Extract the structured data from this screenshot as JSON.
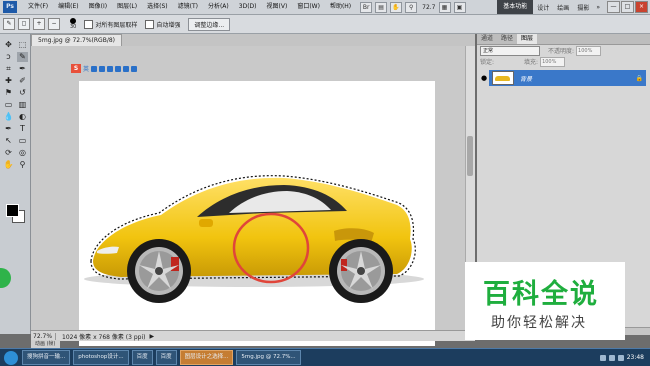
{
  "app": {
    "logo": "Ps"
  },
  "menu": [
    "文件(F)",
    "编辑(E)",
    "图像(I)",
    "图层(L)",
    "选择(S)",
    "滤镜(T)",
    "分析(A)",
    "3D(D)",
    "视图(V)",
    "窗口(W)",
    "帮助(H)"
  ],
  "menu_zoom": "72.7",
  "workspace": {
    "active": "基本功能",
    "items": [
      "设计",
      "绘画",
      "摄影"
    ],
    "more": "»"
  },
  "window_buttons": [
    "—",
    "□",
    "×"
  ],
  "options": {
    "brush_size": "30",
    "antialias_label": "对所有图层取样",
    "auto_enhance_label": "自动增强",
    "refine_button": "调整边缘..."
  },
  "document": {
    "tab": "5mg.jpg @ 72.7%(RGB/8)",
    "zoom": "72.7%",
    "info": "1024 像素 x 768 像素 (3 ppi)",
    "bottom_tab": "动画 (帧)"
  },
  "sogou_toolbar": {
    "logo": "S",
    "label": "英"
  },
  "panel": {
    "tabs": [
      "通道",
      "路径",
      "图层"
    ],
    "active_tab": "图层",
    "blend_mode": "正常",
    "opacity_label": "不透明度:",
    "opacity_value": "100%",
    "lock_label": "锁定:",
    "fill_label": "填充:",
    "fill_value": "100%",
    "layer_name": "背景"
  },
  "watermark": {
    "title": "百科全说",
    "subtitle": "助你轻松解决"
  },
  "taskbar": {
    "apps": [
      "搜狗拼音一输...",
      "photoshop设计...",
      "百度",
      "百度",
      "图层设计之选择...",
      "5mg.jpg @ 72.7%..."
    ],
    "highlight_index": 4,
    "time": "23:48"
  },
  "colors": {
    "car": "#f1c40f",
    "selection_circle": "#e0453a",
    "watermark": "#1fae3e",
    "layer_highlight": "#3a78c9"
  }
}
